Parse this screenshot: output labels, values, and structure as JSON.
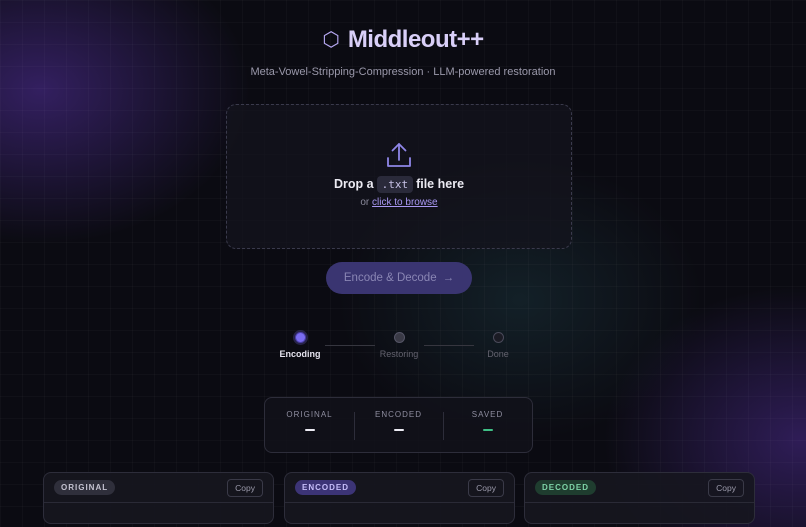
{
  "header": {
    "title": "Middleout++",
    "subtitle": "Meta-Vowel-Stripping-Compression · LLM-powered restoration"
  },
  "dropzone": {
    "text_before": "Drop a",
    "ext": ".txt",
    "text_after": "file here",
    "browse_prefix": "or",
    "browse_link": "click to browse"
  },
  "run_button": {
    "label": "Encode & Decode",
    "arrow": "→"
  },
  "steps": [
    {
      "label": "Encoding",
      "state": "active"
    },
    {
      "label": "Restoring",
      "state": "pending"
    },
    {
      "label": "Done",
      "state": "pending"
    }
  ],
  "stats": [
    {
      "label": "ORIGINAL",
      "value": "—"
    },
    {
      "label": "ENCODED",
      "value": "—"
    },
    {
      "label": "SAVED",
      "value": "—"
    }
  ],
  "panels": [
    {
      "badge": "ORIGINAL",
      "copy": "Copy"
    },
    {
      "badge": "ENCODED",
      "copy": "Copy"
    },
    {
      "badge": "DECODED",
      "copy": "Copy"
    }
  ],
  "colors": {
    "accent": "#7a6cf0",
    "saved_green": "#3fbf86",
    "title": "#d9cff8"
  }
}
